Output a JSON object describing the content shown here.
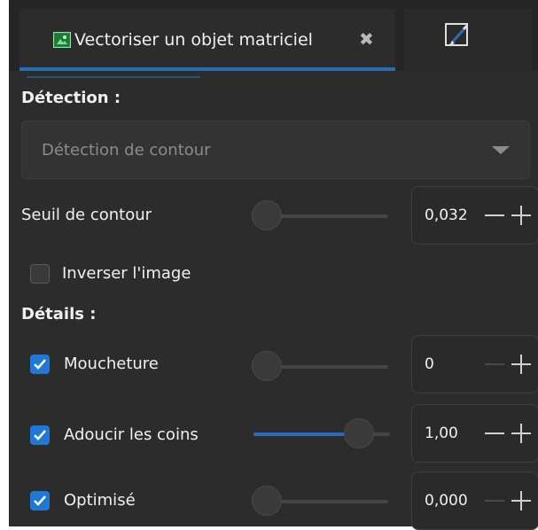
{
  "tabs": {
    "active_label": "Vectoriser un objet matriciel",
    "close_glyph": "✖",
    "active_icon": "image-icon",
    "second_icon": "brush-icon"
  },
  "detection": {
    "title": "Détection :",
    "method_value": "Détection de contour"
  },
  "threshold": {
    "label": "Seuil de contour",
    "value": "0,032",
    "slider_fraction": 0.0
  },
  "invert": {
    "label": "Inverser l'image",
    "checked": false
  },
  "details": {
    "title": "Détails :",
    "speckles": {
      "label": "Moucheture",
      "checked": true,
      "value": "0",
      "slider_fraction": 0.0
    },
    "smooth": {
      "label": "Adoucir les coins",
      "checked": true,
      "value": "1,00",
      "slider_fraction": 0.77
    },
    "optimize": {
      "label": "Optimisé",
      "checked": true,
      "value": "0,000",
      "slider_fraction": 0.0
    }
  },
  "colors": {
    "accent": "#2b6cb8",
    "checkbox_on": "#1f77d6",
    "panel_bg": "#2c2c2c"
  }
}
